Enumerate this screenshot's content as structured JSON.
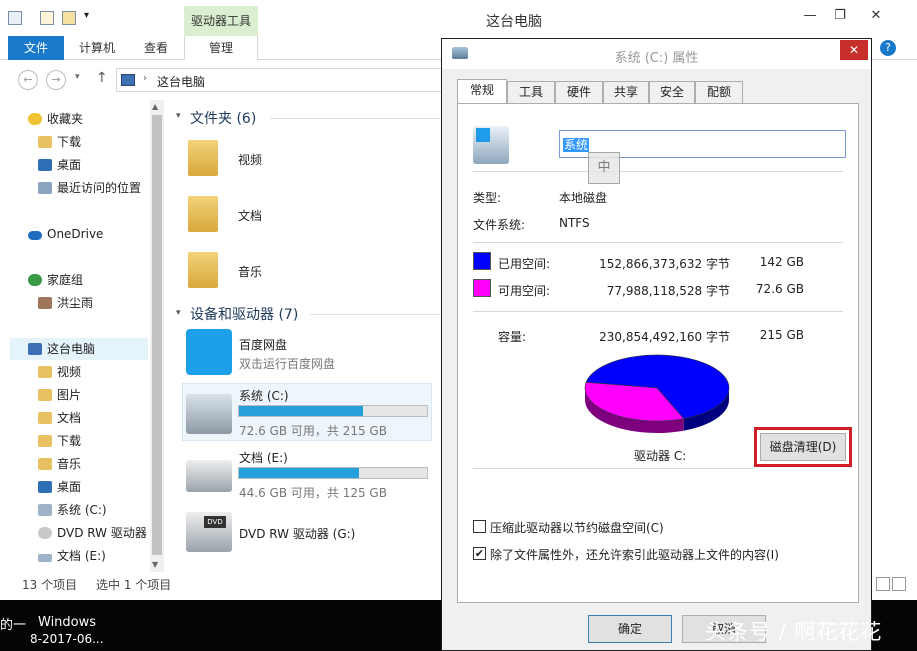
{
  "explorer": {
    "title": "这台电脑",
    "contextual_tab_group": "驱动器工具",
    "tabs": [
      "文件",
      "计算机",
      "查看",
      "管理"
    ],
    "address": "这台电脑",
    "window_controls": [
      "—",
      "❐",
      "✕"
    ],
    "nav": {
      "favorites": "收藏夹",
      "downloads": "下载",
      "desktop": "桌面",
      "recent": "最近访问的位置",
      "onedrive": "OneDrive",
      "homegroup": "家庭组",
      "user": "洪尘雨",
      "this_pc": "这台电脑",
      "videos": "视频",
      "pictures": "图片",
      "documents": "文档",
      "downloads2": "下载",
      "music": "音乐",
      "desktop2": "桌面",
      "drive_c": "系统 (C:)",
      "dvd": "DVD RW 驱动器",
      "drive_e": "文档 (E:)"
    },
    "folders_group": "文件夹 (6)",
    "folders": [
      "视频",
      "文档",
      "音乐"
    ],
    "devices_group": "设备和驱动器 (7)",
    "baidu": {
      "name": "百度网盘",
      "desc": "双击运行百度网盘"
    },
    "drive_c": {
      "name": "系统 (C:)",
      "info": "72.6 GB 可用，共 215 GB",
      "used_fraction": 0.66
    },
    "drive_e": {
      "name": "文档 (E:)",
      "info": "44.6 GB 可用，共 125 GB",
      "used_fraction": 0.64
    },
    "dvd": {
      "name": "DVD RW 驱动器 (G:)",
      "badge": "DVD"
    },
    "status": {
      "count": "13 个项目",
      "selected": "选中 1 个项目"
    }
  },
  "taskbar": {
    "left_text": "的一",
    "line1": "Windows",
    "line2": "8-2017-06..."
  },
  "dialog": {
    "title": "系统 (C:) 属性",
    "close": "✕",
    "tabs": [
      "常规",
      "工具",
      "硬件",
      "共享",
      "安全",
      "配额"
    ],
    "name_value": "系统",
    "ime_indicator": "中",
    "type_label": "类型:",
    "type_value": "本地磁盘",
    "fs_label": "文件系统:",
    "fs_value": "NTFS",
    "used_label": "已用空间:",
    "used_bytes": "152,866,373,632 字节",
    "used_gb": "142 GB",
    "free_label": "可用空间:",
    "free_bytes": "77,988,118,528 字节",
    "free_gb": "72.6 GB",
    "capacity_label": "容量:",
    "capacity_bytes": "230,854,492,160 字节",
    "capacity_gb": "215 GB",
    "drive_label": "驱动器 C:",
    "cleanup_button": "磁盘清理(D)",
    "compress_label": "压缩此驱动器以节约磁盘空间(C)",
    "compress_checked": false,
    "index_label": "除了文件属性外，还允许索引此驱动器上文件的内容(I)",
    "index_checked": true,
    "ok_button": "确定",
    "cancel_button": "取消",
    "used_color": "#0000ff",
    "free_color": "#ff00ff"
  },
  "watermark": "头条号 / 啊花花花"
}
